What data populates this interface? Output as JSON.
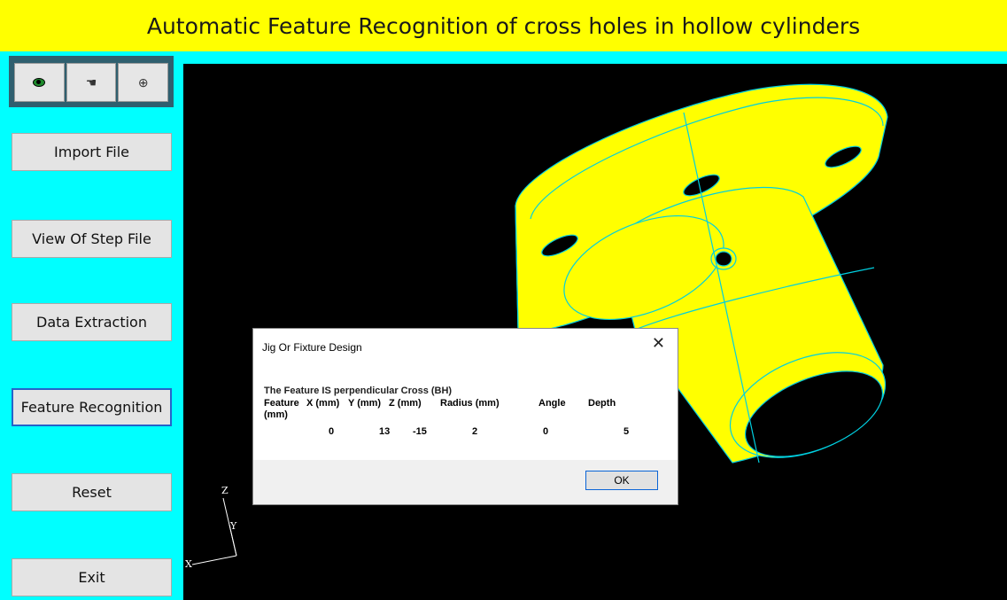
{
  "app": {
    "title": "Automatic Feature Recognition of cross holes in hollow cylinders"
  },
  "toolbar": {
    "icons": [
      "eye-icon",
      "pan-icon",
      "zoom-icon"
    ]
  },
  "sidebar": {
    "buttons": [
      {
        "label": "Import File"
      },
      {
        "label": "View Of Step File"
      },
      {
        "label": "Data Extraction"
      },
      {
        "label": "Feature Recognition"
      },
      {
        "label": "Reset"
      },
      {
        "label": "Exit"
      }
    ]
  },
  "axes": {
    "z": "Z",
    "y": "Y",
    "x": "X"
  },
  "dialog": {
    "title": "Jig Or Fixture Design",
    "close": "✕",
    "message": "The Feature IS  perpendicular Cross (BH)",
    "headers": [
      "Feature",
      "X (mm)",
      "Y (mm)",
      "Z (mm)",
      "Radius (mm)",
      "Angle",
      "Depth"
    ],
    "header_sub": "(mm)",
    "values": [
      "0",
      "13",
      "-15",
      "2",
      "0",
      "5"
    ],
    "ok_label": "OK"
  },
  "colors": {
    "title_bg": "#ffff00",
    "panel_bg": "#00ffff",
    "part": "#ffff00",
    "edges": "#00cfe0"
  }
}
